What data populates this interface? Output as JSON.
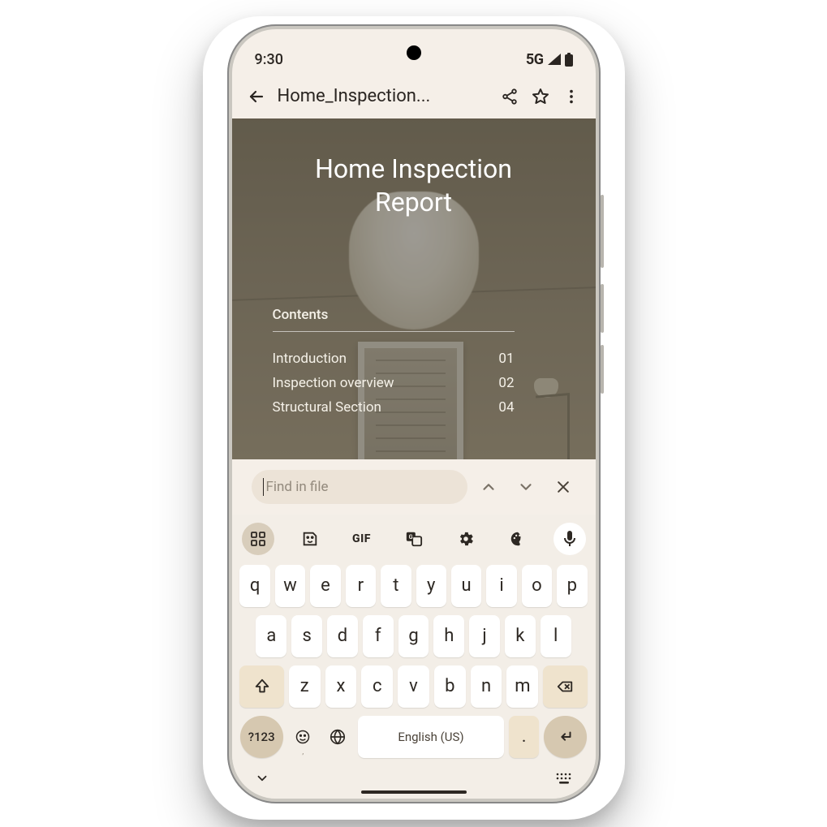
{
  "status": {
    "time": "9:30",
    "network": "5G"
  },
  "appbar": {
    "title": "Home_Inspection...",
    "icons": {
      "back": "arrow-left",
      "share": "share",
      "star": "star",
      "more": "more-vert"
    }
  },
  "document": {
    "title_line1": "Home Inspection",
    "title_line2": "Report",
    "contents_heading": "Contents",
    "toc": [
      {
        "label": "Introduction",
        "page": "01"
      },
      {
        "label": "Inspection overview",
        "page": "02"
      },
      {
        "label": "Structural Section",
        "page": "04"
      }
    ]
  },
  "find": {
    "placeholder": "Find in file",
    "value": "",
    "prev_icon": "chevron-up",
    "next_icon": "chevron-down",
    "close_icon": "close"
  },
  "keyboard": {
    "toolbar": [
      "apps",
      "sticker",
      "gif",
      "translate",
      "settings",
      "palette",
      "mic"
    ],
    "gif_label": "GIF",
    "row1": [
      "q",
      "w",
      "e",
      "r",
      "t",
      "y",
      "u",
      "i",
      "o",
      "p"
    ],
    "row2": [
      "a",
      "s",
      "d",
      "f",
      "g",
      "h",
      "j",
      "k",
      "l"
    ],
    "row3_shift": "shift",
    "row3": [
      "z",
      "x",
      "c",
      "v",
      "b",
      "n",
      "m"
    ],
    "row3_backspace": "backspace",
    "row4": {
      "symbols": "?123",
      "emoji": "emoji",
      "emoji_sub": ",",
      "globe": "globe",
      "space": "English (US)",
      "period": ".",
      "enter": "enter"
    }
  },
  "navstrip": {
    "collapse": "chevron-down",
    "keyboard": "keyboard-icon"
  }
}
